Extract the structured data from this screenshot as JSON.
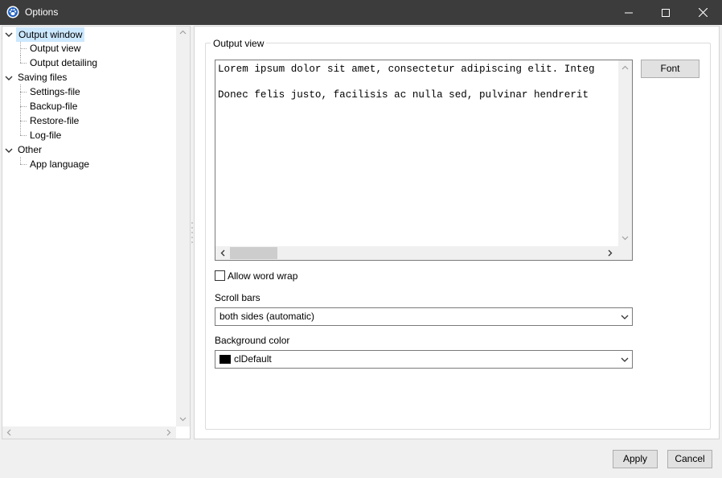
{
  "window": {
    "title": "Options",
    "icon": "paw-app-icon",
    "controls": [
      "minimize-icon",
      "maximize-icon",
      "close-icon"
    ]
  },
  "tree": {
    "items": [
      {
        "label": "Output window",
        "level": 0,
        "expanded": true,
        "selected": true
      },
      {
        "label": "Output view",
        "level": 1
      },
      {
        "label": "Output detailing",
        "level": 1
      },
      {
        "label": "Saving files",
        "level": 0,
        "expanded": true
      },
      {
        "label": "Settings-file",
        "level": 1
      },
      {
        "label": "Backup-file",
        "level": 1
      },
      {
        "label": "Restore-file",
        "level": 1
      },
      {
        "label": "Log-file",
        "level": 1
      },
      {
        "label": "Other",
        "level": 0,
        "expanded": true
      },
      {
        "label": "App language",
        "level": 1
      }
    ]
  },
  "output_view": {
    "group_label": "Output view",
    "memo_lines": [
      "Lorem ipsum dolor sit amet, consectetur adipiscing elit. Integ",
      "Donec felis justo, facilisis ac nulla sed, pulvinar hendrerit"
    ],
    "font_button": "Font",
    "word_wrap_label": "Allow word wrap",
    "word_wrap_checked": false,
    "scroll_bars_label": "Scroll bars",
    "scroll_bars_value": "both sides (automatic)",
    "bg_color_label": "Background color",
    "bg_color_value": "clDefault",
    "bg_color_swatch": "#000000"
  },
  "buttons": {
    "apply": "Apply",
    "cancel": "Cancel"
  },
  "colors": {
    "titlebar": "#3c3c3c",
    "selection": "#cce8ff"
  }
}
